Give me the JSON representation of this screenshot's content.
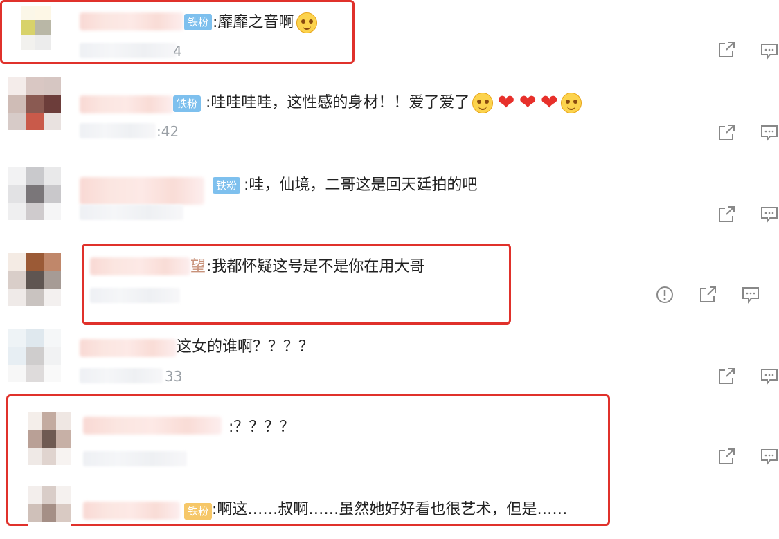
{
  "badge_text": "铁粉",
  "comments": [
    {
      "text": ":靡靡之音啊",
      "time": "4"
    },
    {
      "text": ":哇哇哇哇，这性感的身材！！爱了爱了",
      "time": ":42"
    },
    {
      "text": ":哇，仙境，二哥这是回天廷拍的吧",
      "time": ""
    },
    {
      "name_tail": "望",
      "text": ":我都怀疑这号是不是你在用大哥",
      "time": ""
    },
    {
      "text": "这女的谁啊？？？？",
      "time": "33"
    },
    {
      "name_tail": "",
      "text": ":？？？？",
      "time": ""
    },
    {
      "text": ":啊这……叔啊……虽然她好好看也很艺术，但是……",
      "time": ""
    }
  ],
  "icons": {
    "share": "share-icon",
    "reply": "comment-icon",
    "report": "report-icon"
  },
  "colors": {
    "badge_blue": "#7ec0ee",
    "badge_gold": "#f6c768",
    "highlight_red": "#e0312b",
    "heart": "#e7302b"
  }
}
